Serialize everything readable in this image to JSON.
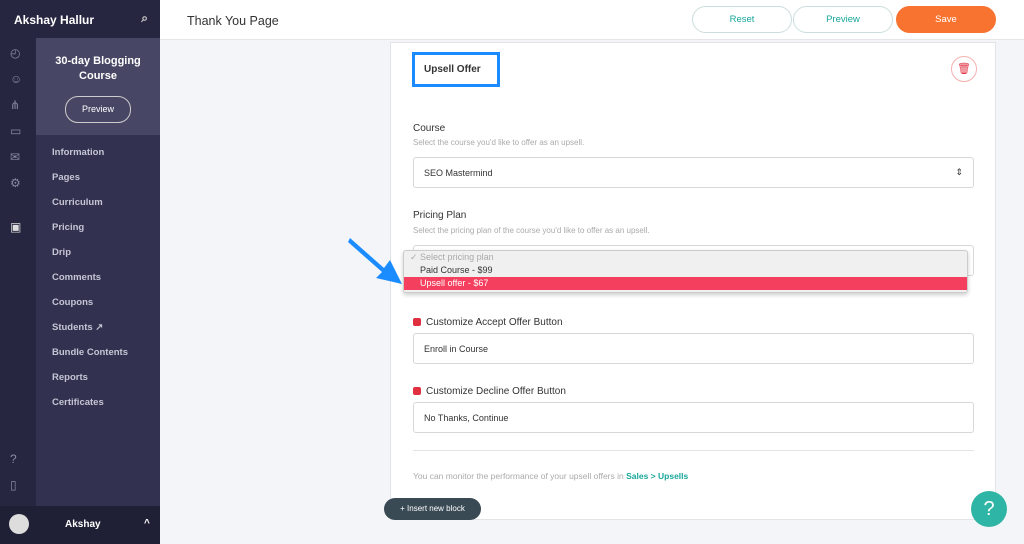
{
  "user": {
    "name": "Akshay Hallur",
    "short": "Akshay"
  },
  "course": {
    "title": "30-day Blogging Course",
    "preview": "Preview"
  },
  "nav": [
    "Information",
    "Pages",
    "Curriculum",
    "Pricing",
    "Drip",
    "Comments",
    "Coupons",
    "Students",
    "Bundle Contents",
    "Reports",
    "Certificates"
  ],
  "header": {
    "title": "Thank You Page",
    "reset": "Reset",
    "preview": "Preview",
    "save": "Save"
  },
  "block": {
    "title": "Upsell Offer",
    "course_label": "Course",
    "course_hint": "Select the course you'd like to offer as an upsell.",
    "course_value": "SEO Mastermind",
    "plan_label": "Pricing Plan",
    "plan_hint": "Select the pricing plan of the course you'd like to offer as an upsell.",
    "plan_options": [
      "Select pricing plan",
      "Paid Course - $99",
      "Upsell offer - $67"
    ],
    "accept_label": "Customize Accept Offer Button",
    "accept_value": "Enroll in Course",
    "decline_label": "Customize Decline Offer Button",
    "decline_value": "No Thanks, Continue",
    "footer": "You can monitor the performance of your upsell offers in",
    "footer_link": "Sales > Upsells"
  },
  "insert": "+ Insert new block",
  "help": "?",
  "colors": {
    "accent": "#f97330",
    "highlight": "#f43f5e",
    "link": "#17a79a"
  }
}
